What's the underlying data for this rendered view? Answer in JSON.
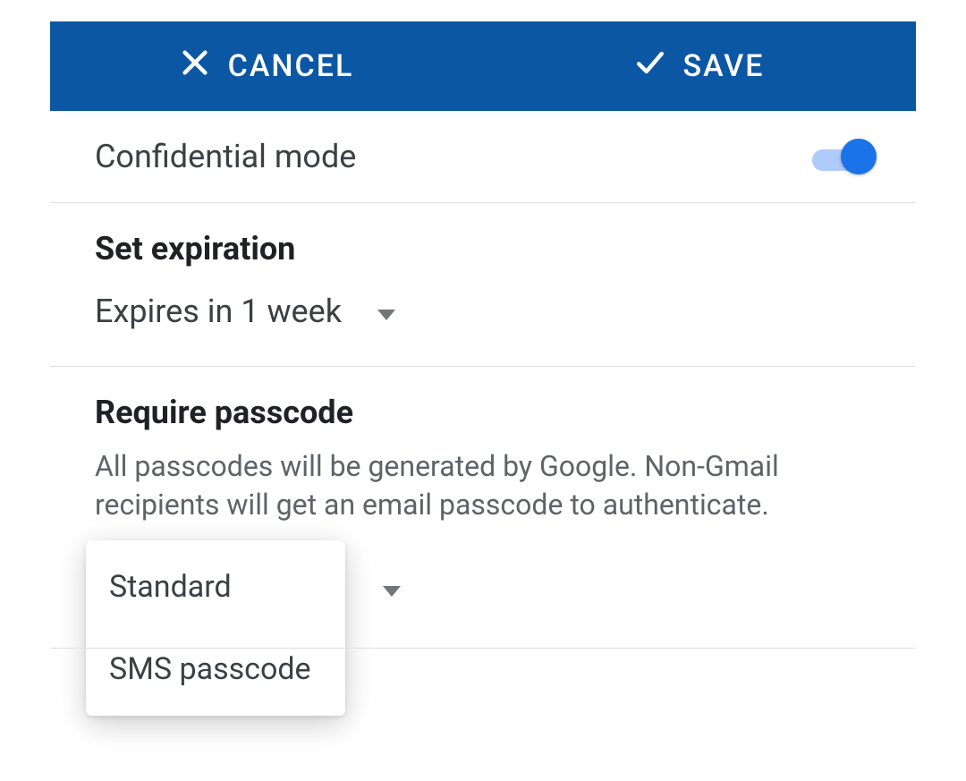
{
  "toolbar": {
    "cancel_label": "CANCEL",
    "save_label": "SAVE"
  },
  "confidential_mode": {
    "title": "Confidential mode",
    "enabled": true
  },
  "expiration": {
    "heading": "Set expiration",
    "selected": "Expires in 1 week"
  },
  "passcode": {
    "heading": "Require passcode",
    "description": "All passcodes will be generated by Google. Non-Gmail recipients will get an email passcode to authenticate.",
    "options": [
      "Standard",
      "SMS passcode"
    ]
  }
}
